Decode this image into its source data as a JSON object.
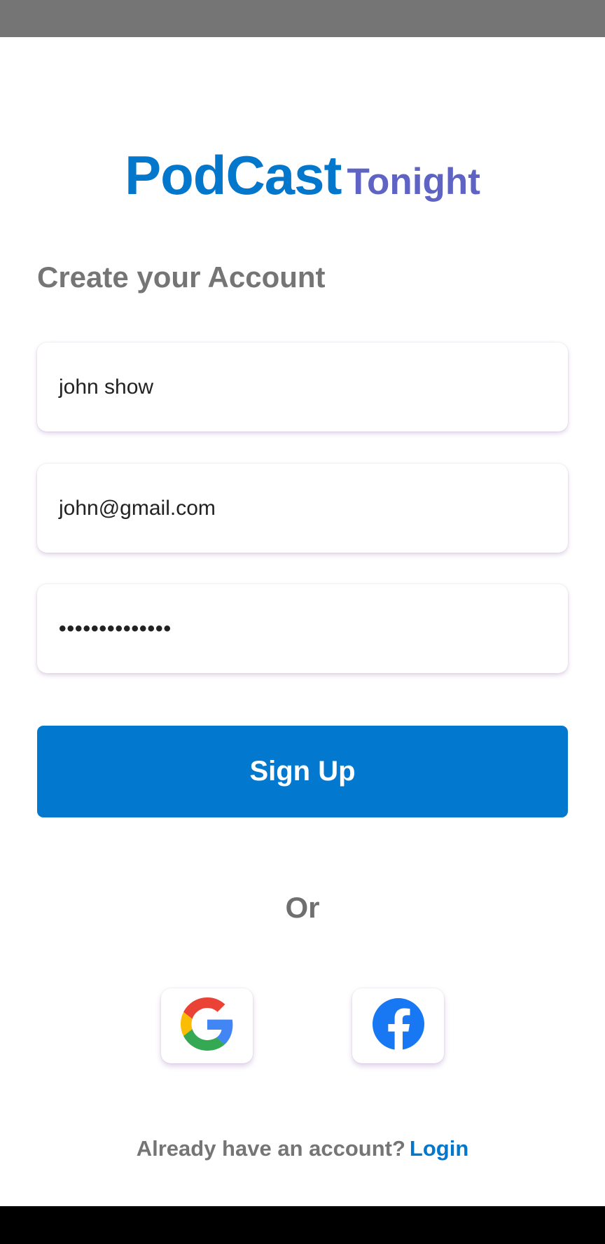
{
  "brand": {
    "name_main": "PodCast",
    "name_sub": "Tonight",
    "primary_color": "#0277CC",
    "secondary_color": "#5E63C4"
  },
  "signup": {
    "title": "Create your Account",
    "fields": {
      "name_value": "john show",
      "email_value": "john@gmail.com",
      "password_value": "••••••••••••••"
    },
    "submit_label": "Sign Up",
    "divider_label": "Or",
    "social": {
      "google_icon": "google-icon",
      "facebook_icon": "facebook-icon"
    }
  },
  "footer": {
    "prompt": "Already have an account?",
    "login_label": "Login"
  }
}
